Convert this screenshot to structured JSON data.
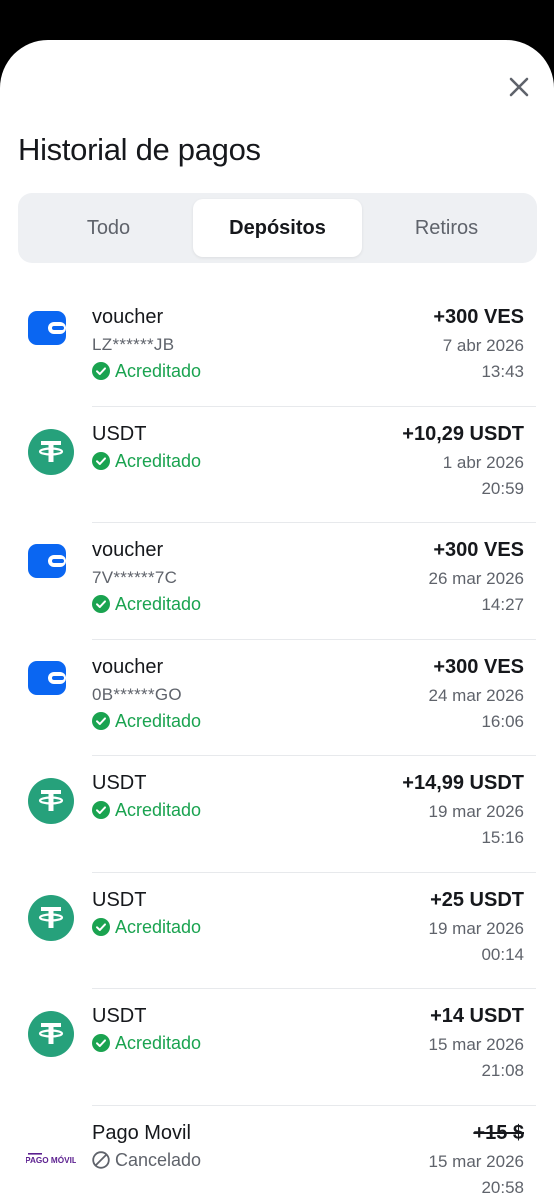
{
  "header": {
    "title": "Historial de pagos",
    "close_icon": "close-icon"
  },
  "tabs": [
    {
      "label": "Todo",
      "active": false
    },
    {
      "label": "Depósitos",
      "active": true
    },
    {
      "label": "Retiros",
      "active": false
    }
  ],
  "colors": {
    "success": "#1aa350",
    "tether": "#26a17b",
    "wallet": "#0a66f2",
    "pago_movil": "#5b1f8f",
    "muted": "#5f636b",
    "tab_bg": "#eef0f3"
  },
  "transactions": [
    {
      "icon": "wallet-icon",
      "name": "voucher",
      "code": "LZ******JB",
      "status": "Acreditado",
      "status_type": "ok",
      "amount": "+300 VES",
      "date": "7 abr 2026",
      "time": "13:43"
    },
    {
      "icon": "tether-icon",
      "name": "USDT",
      "status": "Acreditado",
      "status_type": "ok",
      "amount": "+10,29 USDT",
      "date": "1 abr 2026",
      "time": "20:59"
    },
    {
      "icon": "wallet-icon",
      "name": "voucher",
      "code": "7V******7C",
      "status": "Acreditado",
      "status_type": "ok",
      "amount": "+300 VES",
      "date": "26 mar 2026",
      "time": "14:27"
    },
    {
      "icon": "wallet-icon",
      "name": "voucher",
      "code": "0B******GO",
      "status": "Acreditado",
      "status_type": "ok",
      "amount": "+300 VES",
      "date": "24 mar 2026",
      "time": "16:06"
    },
    {
      "icon": "tether-icon",
      "name": "USDT",
      "status": "Acreditado",
      "status_type": "ok",
      "amount": "+14,99 USDT",
      "date": "19 mar 2026",
      "time": "15:16"
    },
    {
      "icon": "tether-icon",
      "name": "USDT",
      "status": "Acreditado",
      "status_type": "ok",
      "amount": "+25 USDT",
      "date": "19 mar 2026",
      "time": "00:14"
    },
    {
      "icon": "tether-icon",
      "name": "USDT",
      "status": "Acreditado",
      "status_type": "ok",
      "amount": "+14 USDT",
      "date": "15 mar 2026",
      "time": "21:08"
    },
    {
      "icon": "pago-movil-logo",
      "logo_text": "PAGO MÓVIL",
      "name": "Pago Movil",
      "status": "Cancelado",
      "status_type": "cancel",
      "amount": "+15 $",
      "amount_struck": true,
      "date": "15 mar 2026",
      "time": "20:58"
    }
  ]
}
